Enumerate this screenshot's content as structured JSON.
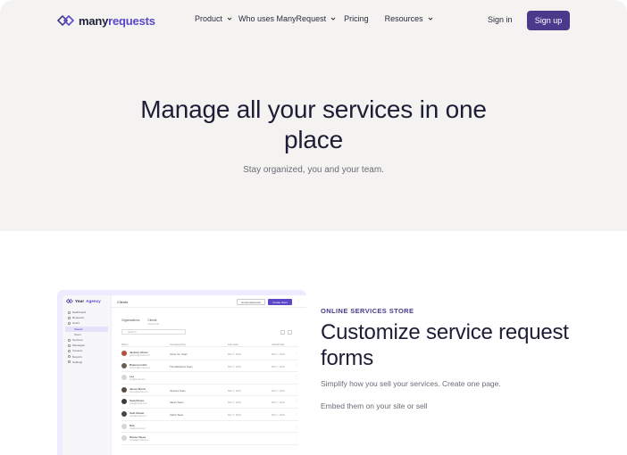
{
  "nav": {
    "logo_main": "many",
    "logo_accent": "requests",
    "items": [
      {
        "label": "Product",
        "has_dropdown": true
      },
      {
        "label": "Who uses ManyRequest",
        "has_dropdown": true
      },
      {
        "label": "Pricing",
        "has_dropdown": false
      },
      {
        "label": "Resources",
        "has_dropdown": true
      }
    ],
    "signin": "Sign in",
    "signup": "Sign up"
  },
  "hero": {
    "title": "Manage all your services in one place",
    "subtitle": "Stay organized, you and your team."
  },
  "feature": {
    "kicker": "ONLINE SERVICES STORE",
    "title": "Customize service request forms",
    "p1": "Simplify how you sell your services. Create one page.",
    "p2": "Embed them on your site or sell"
  },
  "mock": {
    "brand_your": "Your",
    "brand_agency": "Agency",
    "sidebar": [
      {
        "label": "Dashboard",
        "sub": false,
        "active": false
      },
      {
        "label": "Requests",
        "sub": false,
        "active": false
      },
      {
        "label": "Users",
        "sub": false,
        "active": false
      },
      {
        "label": "Clients",
        "sub": true,
        "active": true
      },
      {
        "label": "Team",
        "sub": true,
        "active": false
      },
      {
        "label": "Services",
        "sub": false,
        "active": false
      },
      {
        "label": "Messages",
        "sub": false,
        "active": false
      },
      {
        "label": "Invoices",
        "sub": false,
        "active": false
      },
      {
        "label": "Reports",
        "sub": false,
        "active": false
      },
      {
        "label": "Settings",
        "sub": false,
        "active": false
      }
    ],
    "page_title": "Clients",
    "btn_announcements": "Announcements",
    "btn_create": "Create client",
    "tabs": [
      {
        "label": "Organizations",
        "count": ""
      },
      {
        "label": "Clients",
        "count": "Clients list"
      }
    ],
    "search_placeholder": "Search",
    "columns": [
      "Name",
      "Company/Org",
      "Last seen",
      "Joined/Last"
    ],
    "rows": [
      {
        "name": "Jackson Mover",
        "email": "jackson@email.com",
        "company": "Acme Inc. Team",
        "created": "Mar 7, 2021",
        "last": "Mar 7, 2021",
        "avatar": "#b5523c"
      },
      {
        "name": "Brianna Curtis",
        "email": "brianna@email.com",
        "company": "The Marketers Team",
        "created": "Mar 7, 2021",
        "last": "Mar 7, 2021",
        "avatar": "#6b5d52"
      },
      {
        "name": "Leo",
        "email": "leo@email.com",
        "company": "",
        "created": "",
        "last": "",
        "avatar": "#d8d4cf"
      },
      {
        "name": "James Burns",
        "email": "james@email.com",
        "company": "James's Team",
        "created": "Mar 7, 2021",
        "last": "Mar 7, 2021",
        "avatar": "#5a4a40"
      },
      {
        "name": "Sara Moore",
        "email": "sara@email.com",
        "company": "Sara's Team",
        "created": "Mar 7, 2021",
        "last": "Mar 7, 2021",
        "avatar": "#3f3a36"
      },
      {
        "name": "Seth Mosier",
        "email": "seth@email.com",
        "company": "Seth's Team",
        "created": "Mar 7, 2021",
        "last": "Mar 7, 2021",
        "avatar": "#4a4540"
      },
      {
        "name": "Rita",
        "email": "rita@email.com",
        "company": "",
        "created": "",
        "last": "",
        "avatar": "#d8d4cf"
      },
      {
        "name": "Nicole Hayes",
        "email": "nicole@email.com",
        "company": "",
        "created": "",
        "last": "",
        "avatar": "#d8d4cf"
      }
    ]
  },
  "colors": {
    "brand": "#4a3a8c",
    "accent": "#5b47c8",
    "hero_bg": "#f4f3f1"
  }
}
